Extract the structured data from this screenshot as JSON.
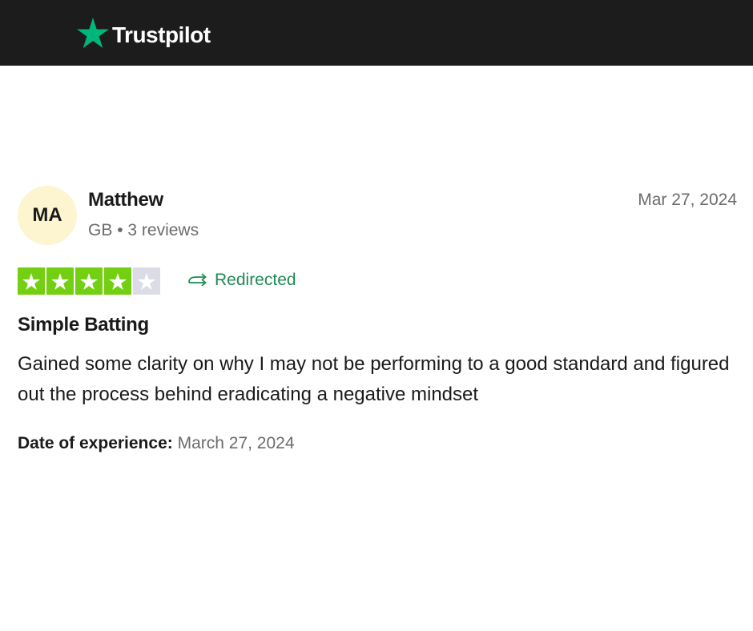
{
  "header": {
    "brand_name": "Trustpilot",
    "brand_color": "#00b67a",
    "background": "#1c1c1c",
    "logo_icon": "star-icon"
  },
  "review": {
    "avatar_initials": "MA",
    "avatar_color": "#fcf5cf",
    "reviewer_name": "Matthew",
    "country": "GB",
    "separator": "•",
    "reviews_count": "3 reviews",
    "date": "Mar 27, 2024",
    "rating": 4,
    "rating_max": 5,
    "star_color": "#73cf11",
    "redirect_label": "Redirected",
    "redirect_icon": "redirect-arrow-icon",
    "title": "Simple Batting",
    "body": "Gained some clarity on why I may not be performing to a good standard and figured out the process behind eradicating a negative mindset",
    "experience_label": "Date of experience:",
    "experience_date": "March 27, 2024"
  }
}
